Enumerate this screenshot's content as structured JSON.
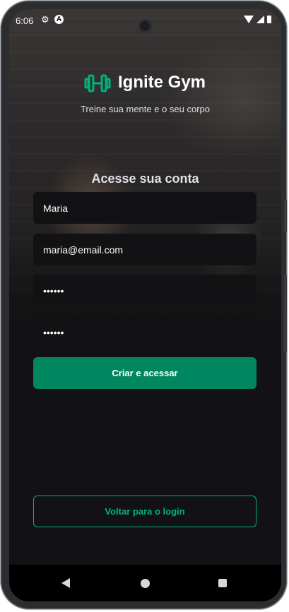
{
  "status_bar": {
    "time": "6:06",
    "icons": [
      "gear-icon",
      "a-icon",
      "wifi-icon",
      "signal-icon",
      "battery-icon"
    ]
  },
  "brand": {
    "title": "Ignite Gym",
    "subtitle": "Treine sua mente e o seu corpo",
    "icon": "dumbbell-icon",
    "accent": "#00b37e"
  },
  "form": {
    "heading": "Acesse sua conta",
    "name_value": "Maria",
    "email_value": "maria@email.com",
    "password_value": "••••••",
    "confirm_password_value": "••••••",
    "submit_label": "Criar e acessar"
  },
  "back_label": "Voltar para o login",
  "nav": [
    "back-icon",
    "home-icon",
    "recents-icon"
  ],
  "colors": {
    "background": "#121214",
    "primary": "#00875f",
    "accent": "#00b37e"
  }
}
